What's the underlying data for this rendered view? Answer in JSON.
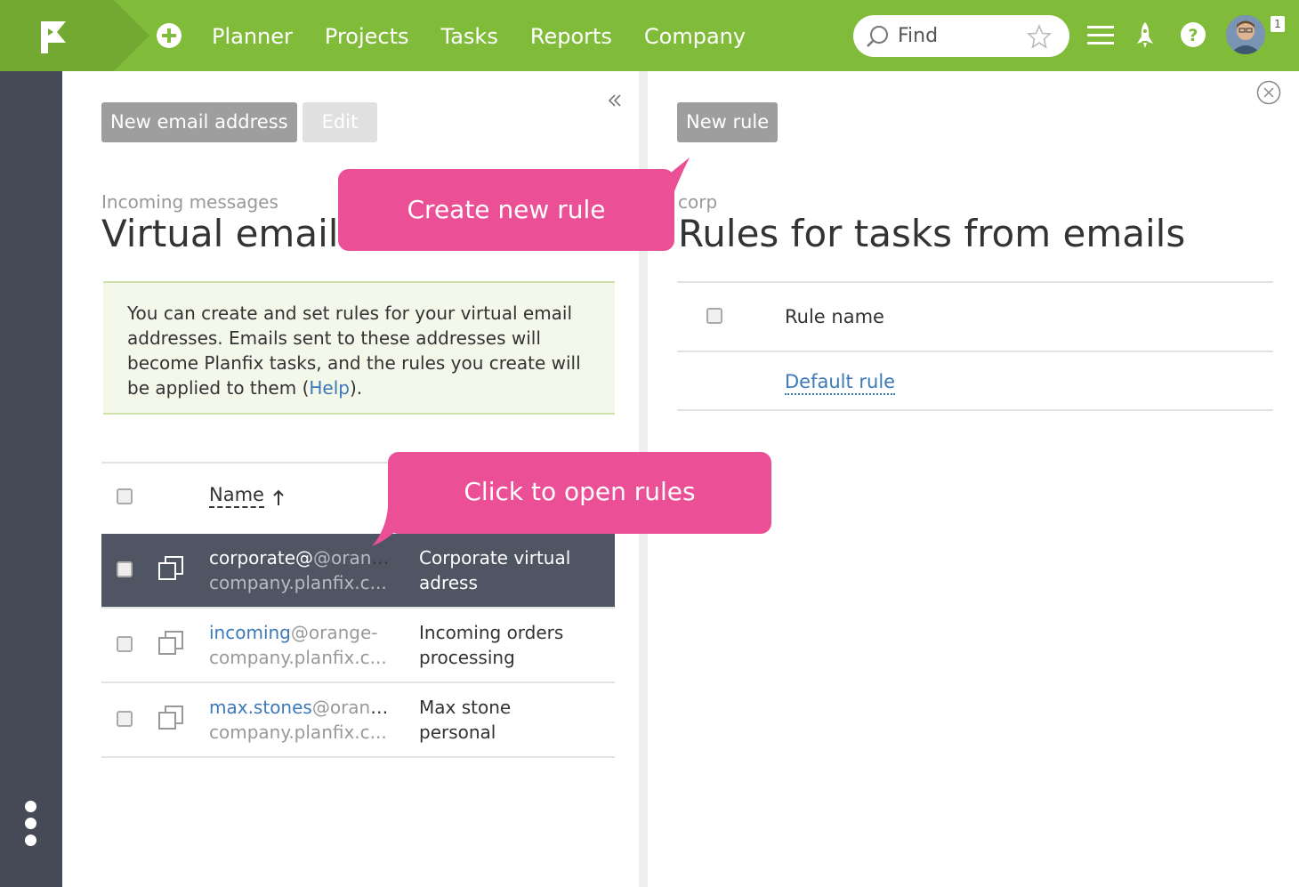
{
  "topbar": {
    "nav": [
      "Planner",
      "Projects",
      "Tasks",
      "Reports",
      "Company"
    ],
    "search_placeholder": "Find",
    "notification_count": "1"
  },
  "left": {
    "new_email_button": "New email address",
    "edit_button": "Edit",
    "subtitle": "Incoming messages",
    "title": "Virtual email",
    "info_text_1": "You can create and set rules for your virtual email addresses. Emails sent to these addresses will become Planfix tasks, and the rules you create will be applied to them (",
    "info_link": "Help",
    "info_text_2": ").",
    "name_header": "Name",
    "rows": [
      {
        "user": "corporate@",
        "domain1": "@orange-",
        "domain2": "company.planfix.c...",
        "desc1": "Corporate virtual",
        "desc2": "adress"
      },
      {
        "user": "incoming",
        "domain1": "@orange-",
        "domain2": "company.planfix.c...",
        "desc1": "Incoming orders",
        "desc2": "processing"
      },
      {
        "user": "max.stones",
        "domain1": "@orang...",
        "domain2": "company.planfix.c...",
        "desc1": "Max stone",
        "desc2": "personal"
      }
    ]
  },
  "right": {
    "new_rule_button": "New rule",
    "subtitle": "corp",
    "title": "Rules for tasks from emails",
    "rule_name_header": "Rule name",
    "rules": [
      "Default rule"
    ]
  },
  "callouts": {
    "create_rule": "Create new rule",
    "open_rules": "Click to open rules"
  },
  "colors": {
    "topbar": "#80bb3a",
    "sidebar": "#464a57",
    "callout": "#eb4f96",
    "selected_row": "#505564",
    "link": "#3d79b8"
  }
}
